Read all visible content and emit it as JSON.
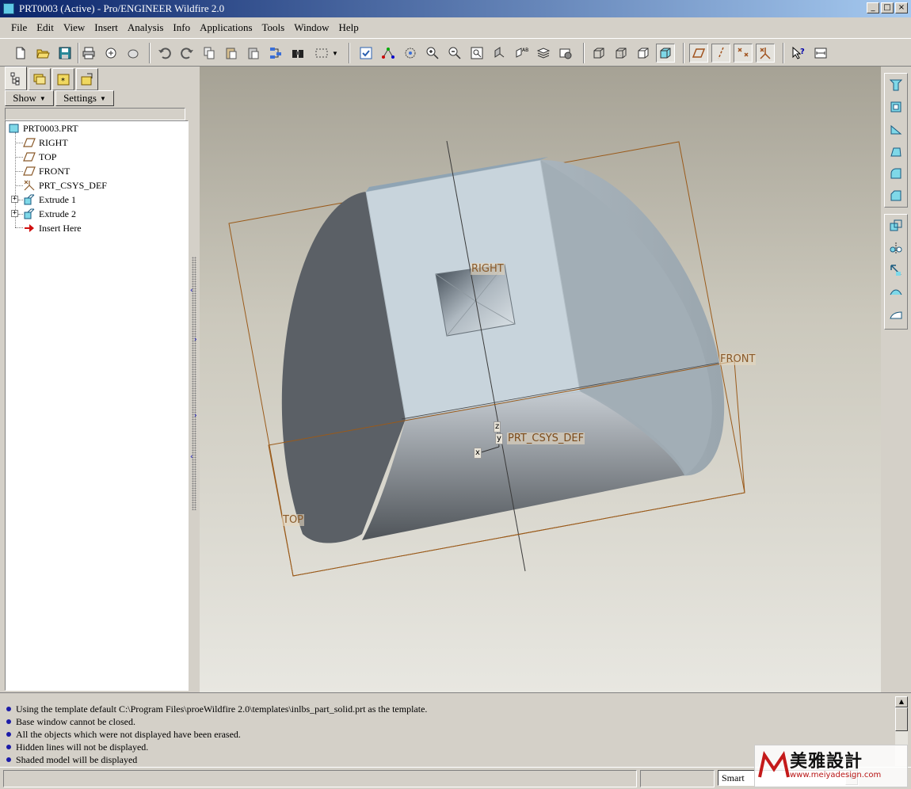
{
  "window": {
    "title": "PRT0003 (Active) - Pro/ENGINEER Wildfire 2.0",
    "minimize": "_",
    "maximize": "□",
    "close": "×"
  },
  "menu": [
    "File",
    "Edit",
    "View",
    "Insert",
    "Analysis",
    "Info",
    "Applications",
    "Tools",
    "Window",
    "Help"
  ],
  "panel": {
    "show_label": "Show",
    "settings_label": "Settings",
    "tree": {
      "root": "PRT0003.PRT",
      "items": [
        "RIGHT",
        "TOP",
        "FRONT",
        "PRT_CSYS_DEF",
        "Extrude 1",
        "Extrude 2",
        "Insert Here"
      ]
    }
  },
  "viewport": {
    "labels": {
      "right": "RIGHT",
      "front": "FRONT",
      "top": "TOP",
      "csys": "PRT_CSYS_DEF",
      "axis_z": "z",
      "axis_y": "y",
      "axis_x": "x"
    },
    "colors": {
      "datum_plane": "#b5651d",
      "model_face": "#c8d4dc",
      "model_dark": "#5b6066"
    }
  },
  "messages": [
    "Using the template default C:\\Program Files\\proeWildfire 2.0\\templates\\inlbs_part_solid.prt as the template.",
    "Base window cannot be closed.",
    "All the objects which were not displayed have been erased.",
    "Hidden lines will not be displayed.",
    "Shaded model will be displayed"
  ],
  "status": {
    "filter": "Smart"
  },
  "watermark": {
    "brand": "美雅設計",
    "url": "www.meiyadesign.com"
  }
}
